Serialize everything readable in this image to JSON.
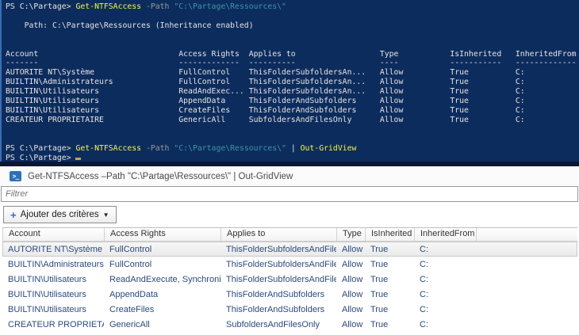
{
  "colors": {
    "console_bg": "#0d2c5e",
    "console_border": "#3b6fb2",
    "console_bottom_strip": "#0a1733",
    "console_fg": "#e6e4df",
    "cmdlet_yellow": "#f5f543",
    "param_gray": "#999999",
    "string_teal": "#3a96a6",
    "cursor_orange": "#c9a050",
    "grid_text_navy": "#2b4a7d",
    "ps_icon_blue": "#2b71b8",
    "plus_blue": "#2a6bc5"
  },
  "console": {
    "prompt": "PS C:\\Partage>",
    "cmdlet": "Get-NTFSAccess",
    "param": "-Path",
    "arg": "\"C:\\Partage\\Ressources\\\"",
    "pipe": "|",
    "pipe_cmdlet": "Out-GridView",
    "path_line": "Path: C:\\Partage\\Ressources (Inheritance enabled)",
    "table": {
      "headers": [
        "Account",
        "Access Rights",
        "Applies to",
        "Type",
        "IsInherited",
        "InheritedFrom"
      ],
      "rows": [
        [
          "AUTORITE NT\\Système",
          "FullControl",
          "ThisFolderSubfoldersAn...",
          "Allow",
          "True",
          "C:"
        ],
        [
          "BUILTIN\\Administrateurs",
          "FullControl",
          "ThisFolderSubfoldersAn...",
          "Allow",
          "True",
          "C:"
        ],
        [
          "BUILTIN\\Utilisateurs",
          "ReadAndExec...",
          "ThisFolderSubfoldersAn...",
          "Allow",
          "True",
          "C:"
        ],
        [
          "BUILTIN\\Utilisateurs",
          "AppendData",
          "ThisFolderAndSubfolders",
          "Allow",
          "True",
          "C:"
        ],
        [
          "BUILTIN\\Utilisateurs",
          "CreateFiles",
          "ThisFolderAndSubfolders",
          "Allow",
          "True",
          "C:"
        ],
        [
          "CREATEUR PROPRIETAIRE",
          "GenericAll",
          "SubfoldersAndFilesOnly",
          "Allow",
          "True",
          "C:"
        ]
      ]
    }
  },
  "gridview": {
    "title": "Get-NTFSAccess –Path \"C:\\Partage\\Ressources\\\" | Out-GridView",
    "ps_icon_glyph": ">_",
    "filter_placeholder": "Filtrer",
    "add_criteria_label": "Ajouter des critères",
    "plus_glyph": "+",
    "caret_glyph": "▼",
    "columns": [
      "Account",
      "Access Rights",
      "Applies to",
      "Type",
      "IsInherited",
      "InheritedFrom"
    ],
    "rows": [
      [
        "AUTORITE NT\\Système",
        "FullControl",
        "ThisFolderSubfoldersAndFiles",
        "Allow",
        "True",
        "C:"
      ],
      [
        "BUILTIN\\Administrateurs",
        "FullControl",
        "ThisFolderSubfoldersAndFiles",
        "Allow",
        "True",
        "C:"
      ],
      [
        "BUILTIN\\Utilisateurs",
        "ReadAndExecute, Synchronize",
        "ThisFolderSubfoldersAndFiles",
        "Allow",
        "True",
        "C:"
      ],
      [
        "BUILTIN\\Utilisateurs",
        "AppendData",
        "ThisFolderAndSubfolders",
        "Allow",
        "True",
        "C:"
      ],
      [
        "BUILTIN\\Utilisateurs",
        "CreateFiles",
        "ThisFolderAndSubfolders",
        "Allow",
        "True",
        "C:"
      ],
      [
        "CREATEUR PROPRIETAIRE",
        "GenericAll",
        "SubfoldersAndFilesOnly",
        "Allow",
        "True",
        "C:"
      ]
    ],
    "selected_row_index": 0
  }
}
